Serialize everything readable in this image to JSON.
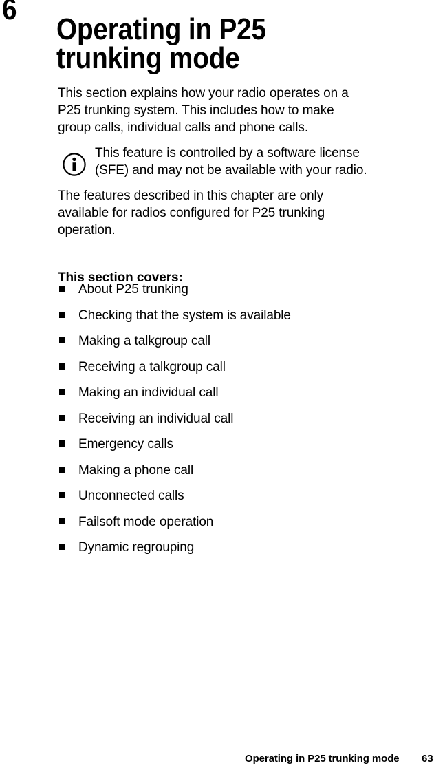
{
  "chapter": {
    "number": "6",
    "title_line_1": "Operating in P25",
    "title_line_2": "trunking mode"
  },
  "intro_paragraph": {
    "line_1": "This section explains how your radio operates on a",
    "line_2": "P25 trunking system. This includes how to make",
    "line_3": "group calls, individual calls and phone calls."
  },
  "note": {
    "icon": "info-circle-icon",
    "line_1": "This feature is controlled by a software license",
    "line_2": "(SFE) and may not be available with your radio."
  },
  "chapter_scope_paragraph": {
    "line_1": "The features described in this chapter are only",
    "line_2": "available for radios configured for P25 trunking",
    "line_3": "operation."
  },
  "covers": {
    "heading": "This section covers:",
    "items": [
      {
        "label": "About P25 trunking"
      },
      {
        "label": "Checking that the system is available"
      },
      {
        "label": "Making a talkgroup call"
      },
      {
        "label": "Receiving a talkgroup call"
      },
      {
        "label": "Making an individual call"
      },
      {
        "label": "Receiving an individual call"
      },
      {
        "label": "Emergency calls"
      },
      {
        "label": "Making a phone call"
      },
      {
        "label": "Unconnected calls"
      },
      {
        "label": "Failsoft mode operation"
      },
      {
        "label": "Dynamic regrouping"
      }
    ]
  },
  "footer": {
    "title": "Operating in P25 trunking mode",
    "page_number": "63"
  },
  "colors": {
    "text": "#000000",
    "background": "#ffffff"
  }
}
